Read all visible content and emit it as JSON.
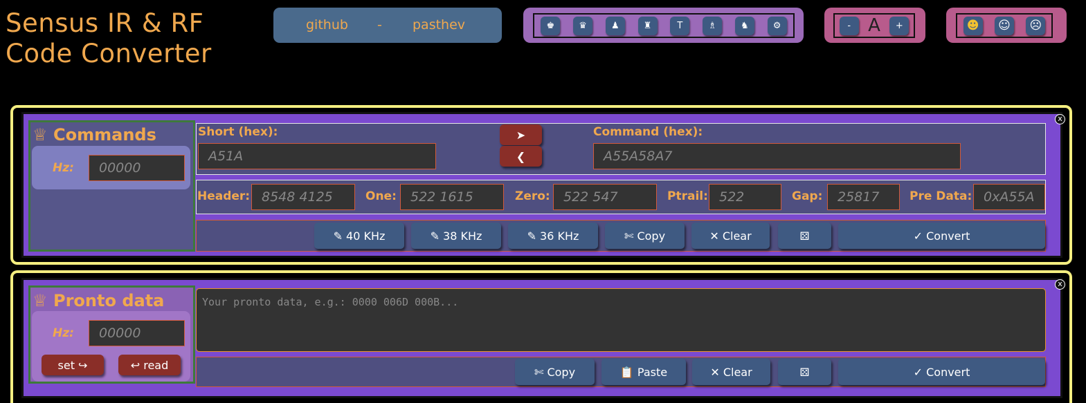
{
  "app": {
    "title_line1": "Sensus IR & RF",
    "title_line2": "Code Converter"
  },
  "links": {
    "github": "github",
    "separator": "-",
    "author": "pasthev"
  },
  "theme_buttons": [
    {
      "icon": "white-king-icon",
      "glyph": "♚"
    },
    {
      "icon": "white-queen-icon",
      "glyph": "♛"
    },
    {
      "icon": "pawn-icon",
      "glyph": "♟"
    },
    {
      "icon": "rook-icon",
      "glyph": "♜"
    },
    {
      "icon": "t-icon",
      "glyph": "T"
    },
    {
      "icon": "rocket-icon",
      "glyph": "♗"
    },
    {
      "icon": "knight-icon",
      "glyph": "♞"
    },
    {
      "icon": "gear-icon",
      "glyph": "⚙"
    }
  ],
  "font_controls": {
    "minus": "-",
    "letter": "A",
    "plus": "+"
  },
  "mood_buttons": [
    {
      "icon": "smile-icon",
      "glyph": "☻"
    },
    {
      "icon": "neutral-icon",
      "glyph": "☺"
    },
    {
      "icon": "sad-icon",
      "glyph": "☹"
    }
  ],
  "commands": {
    "title": "Commands",
    "crown_icon": "♕",
    "hz_label": "Hz:",
    "hz_placeholder": "00000",
    "short_label": "Short (hex):",
    "short_placeholder": "A51A",
    "command_label": "Command (hex):",
    "command_placeholder": "A55A58A7",
    "arrow_right": "➤",
    "arrow_left": "❮",
    "header_label": "Header:",
    "header_placeholder": "8548  4125",
    "one_label": "One:",
    "one_placeholder": "522  1615",
    "zero_label": "Zero:",
    "zero_placeholder": "522   547",
    "ptrail_label": "Ptrail:",
    "ptrail_placeholder": "522",
    "gap_label": "Gap:",
    "gap_placeholder": "25817",
    "predata_label": "Pre Data:",
    "predata_placeholder": "0xA55A",
    "buttons": {
      "khz40": "✎ 40 KHz",
      "khz38": "✎ 38 KHz",
      "khz36": "✎ 36 KHz",
      "copy": "✄ Copy",
      "clear": "✕ Clear",
      "dice": "⚄",
      "convert": "✓ Convert"
    },
    "close": "x"
  },
  "pronto": {
    "title": "Pronto data",
    "crown_icon": "♕",
    "hz_label": "Hz:",
    "hz_placeholder": "00000",
    "set_label": "set ↪",
    "read_label": "↩ read",
    "textarea_placeholder": "Your pronto data, e.g.: 0000 006D 000B...",
    "buttons": {
      "copy": "✄ Copy",
      "paste": "📋 Paste",
      "clear": "✕ Clear",
      "dice": "⚄",
      "convert": "✓ Convert"
    },
    "close": "x"
  }
}
